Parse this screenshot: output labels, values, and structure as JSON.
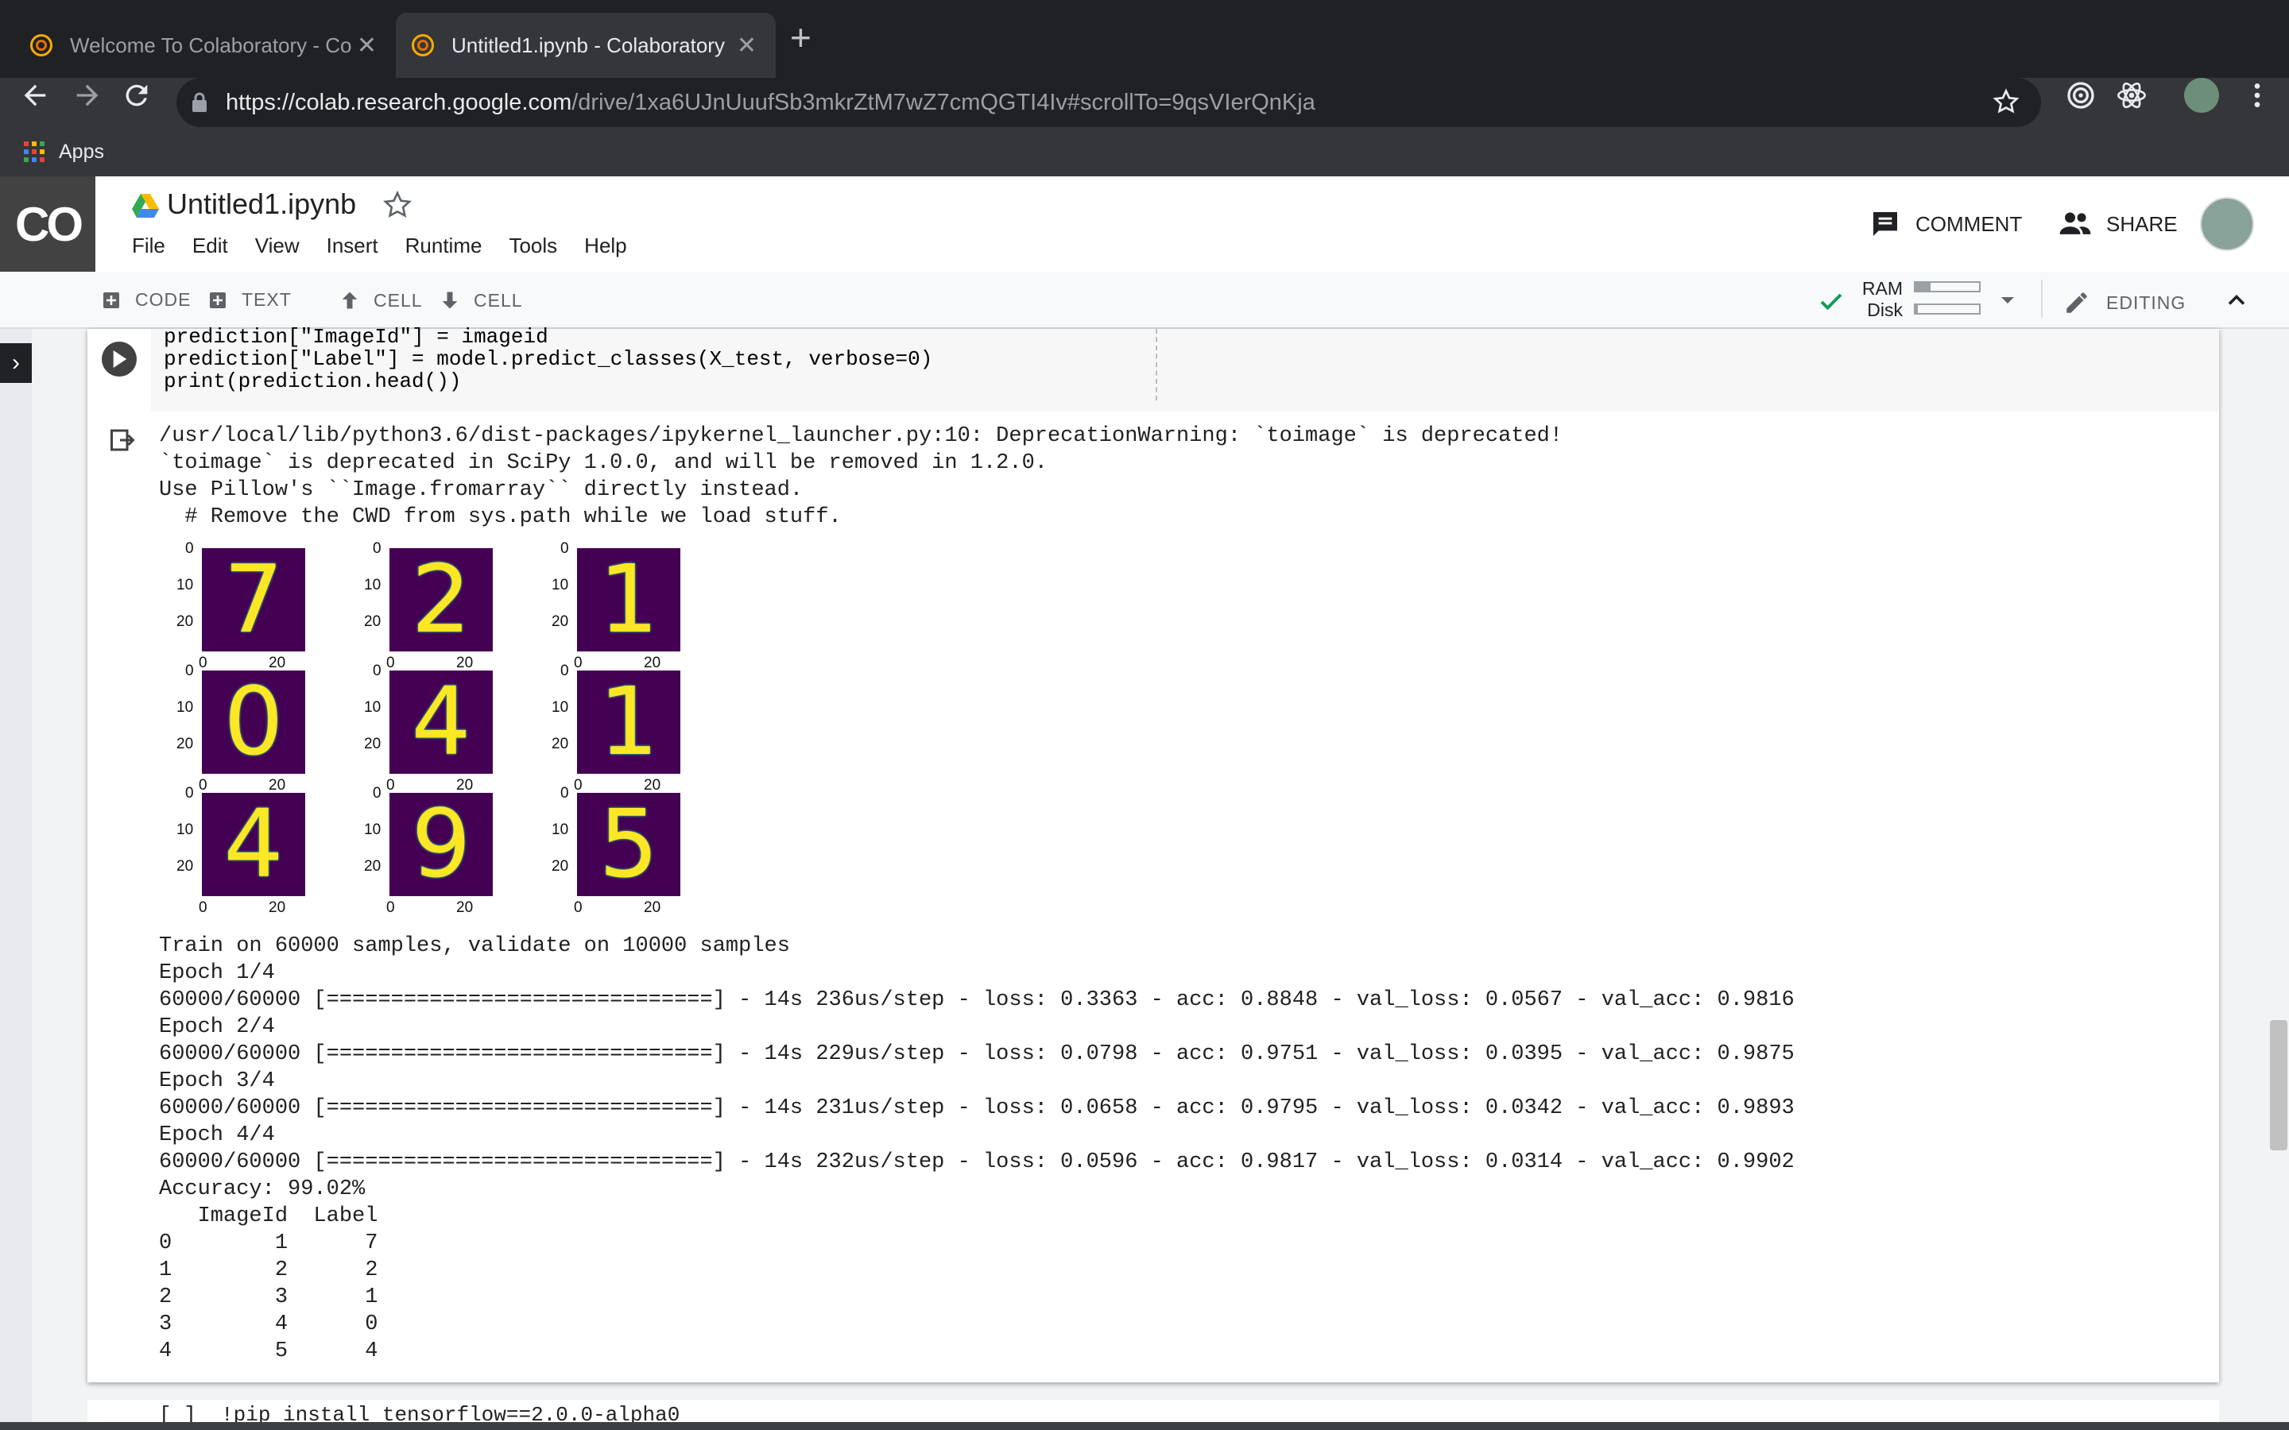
{
  "browser": {
    "tabs": [
      {
        "title": "Welcome To Colaboratory - Co",
        "close": "✕"
      },
      {
        "title": "Untitled1.ipynb - Colaboratory",
        "close": "✕"
      }
    ],
    "new_tab": "+",
    "url_host": "https://colab.research.google.com",
    "url_path": "/drive/1xa6UJnUuufSb3mkrZtM7wZ7cmQGTI4Iv#scrollTo=9qsVIerQnKja",
    "bookmark_apps": "Apps"
  },
  "colab": {
    "logo": "CO",
    "notebook_title": "Untitled1.ipynb",
    "menu": [
      "File",
      "Edit",
      "View",
      "Insert",
      "Runtime",
      "Tools",
      "Help"
    ],
    "comment_label": "COMMENT",
    "share_label": "SHARE",
    "toolbar": {
      "code": "CODE",
      "text": "TEXT",
      "cell_up": "CELL",
      "cell_down": "CELL",
      "ram": "RAM",
      "disk": "Disk",
      "editing": "EDITING"
    },
    "accent": "#1a73e8"
  },
  "cell": {
    "code_lines": [
      "prediction[\"ImageId\"] = imageid",
      "prediction[\"Label\"] = model.predict_classes(X_test, verbose=0)",
      "print(prediction.head())"
    ],
    "warning_output": "/usr/local/lib/python3.6/dist-packages/ipykernel_launcher.py:10: DeprecationWarning: `toimage` is deprecated!\n`toimage` is deprecated in SciPy 1.0.0, and will be removed in 1.2.0.\nUse Pillow's ``Image.fromarray`` directly instead.\n  # Remove the CWD from sys.path while we load stuff.",
    "digits": [
      "7",
      "2",
      "1",
      "0",
      "4",
      "1",
      "4",
      "9",
      "5"
    ],
    "y_ticks": [
      "0",
      "10",
      "20"
    ],
    "x_ticks": [
      "0",
      "20"
    ],
    "training_output": "Train on 60000 samples, validate on 10000 samples\nEpoch 1/4\n60000/60000 [==============================] - 14s 236us/step - loss: 0.3363 - acc: 0.8848 - val_loss: 0.0567 - val_acc: 0.9816\nEpoch 2/4\n60000/60000 [==============================] - 14s 229us/step - loss: 0.0798 - acc: 0.9751 - val_loss: 0.0395 - val_acc: 0.9875\nEpoch 3/4\n60000/60000 [==============================] - 14s 231us/step - loss: 0.0658 - acc: 0.9795 - val_loss: 0.0342 - val_acc: 0.9893\nEpoch 4/4\n60000/60000 [==============================] - 14s 232us/step - loss: 0.0596 - acc: 0.9817 - val_loss: 0.0314 - val_acc: 0.9902\nAccuracy: 99.02%\n   ImageId  Label\n0        1      7\n1        2      2\n2        3      1\n3        4      0\n4        5      4",
    "next_cell_code": "[ ]  !pip install tensorflow==2.0.0-alpha0"
  }
}
